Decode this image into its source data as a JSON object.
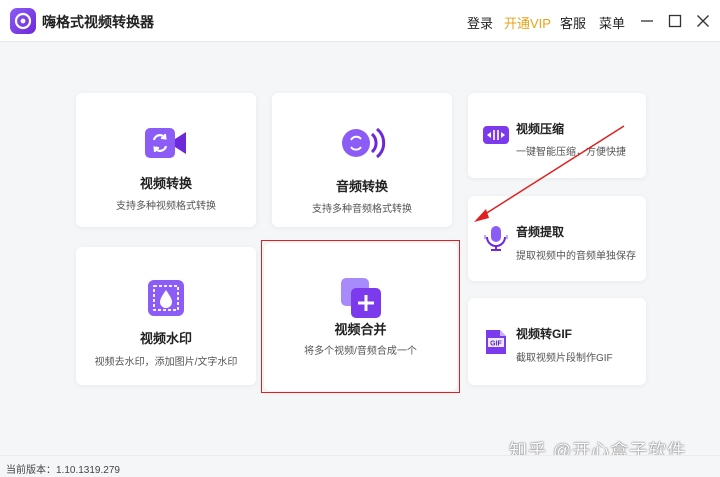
{
  "app": {
    "title": "嗨格式视频转换器"
  },
  "menu": {
    "login": "登录",
    "vip": "开通VIP",
    "service": "客服",
    "menu": "菜单"
  },
  "features": {
    "video_convert": {
      "title": "视频转换",
      "desc": "支持多种视频格式转换",
      "icon": "video-convert-icon"
    },
    "audio_convert": {
      "title": "音频转换",
      "desc": "支持多种音频格式转换",
      "icon": "audio-convert-icon"
    },
    "video_compress": {
      "title": "视频压缩",
      "desc": "一键智能压缩，方便快捷",
      "icon": "video-compress-icon"
    },
    "audio_extract": {
      "title": "音频提取",
      "desc": "提取视频中的音频单独保存",
      "icon": "microphone-icon"
    },
    "video_watermark": {
      "title": "视频水印",
      "desc": "视频去水印，添加图片/文字水印",
      "icon": "watermark-icon"
    },
    "video_merge": {
      "title": "视频合并",
      "desc": "将多个视频/音频合成一个",
      "icon": "merge-icon"
    },
    "video_gif": {
      "title": "视频转GIF",
      "desc": "截取视频片段制作GIF",
      "icon": "gif-icon",
      "badge": "GIF"
    }
  },
  "watermark": "知乎 @开心盒子软件",
  "status": {
    "version": "当前版本：1.10.1319.279"
  },
  "colors": {
    "accent": "#7c3aed",
    "vip": "#e8a317",
    "highlight": "#e02020"
  }
}
